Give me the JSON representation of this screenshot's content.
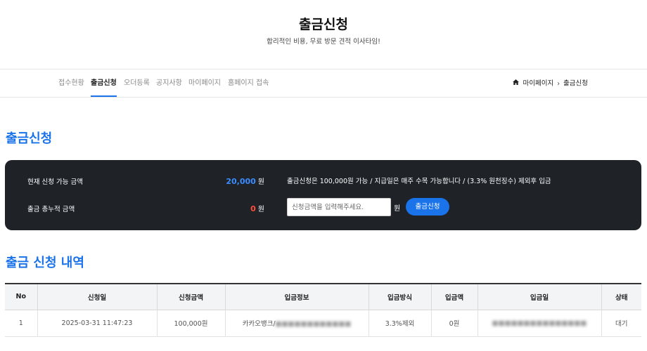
{
  "header": {
    "title": "출금신청",
    "subtitle": "합리적인 비용, 무료 방문 견적 이사타임!"
  },
  "nav": {
    "tabs": [
      "접수현황",
      "출금신청",
      "오더등록",
      "공지사항",
      "마이페이지",
      "홈페이지 접속"
    ],
    "active": "출금신청"
  },
  "breadcrumb": {
    "items": [
      "마이페이지",
      "출금신청"
    ],
    "separator": "›"
  },
  "withdraw": {
    "section_title": "출금신청",
    "available_label": "현재 신청 가능 금액",
    "available_amount": "20,000",
    "total_label": "출금 총누적 금액",
    "total_amount": "0",
    "unit": "원",
    "notice": "출금신청은 100,000원 가능 / 지급일은 매주 수목 가능합니다 / (3.3% 원천징수) 제외후 입금",
    "input_placeholder": "신청금액을 입력해주세요.",
    "input_unit": "원",
    "submit_label": "출금신청"
  },
  "history": {
    "section_title": "출금 신청 내역",
    "columns": [
      "No",
      "신청일",
      "신청금액",
      "입금정보",
      "입금방식",
      "입금액",
      "입금일",
      "상태"
    ],
    "rows": [
      [
        "1",
        "2025-03-31 11:47:23",
        "100,000원",
        "카카오뱅크/",
        "3.3%제외",
        "0원",
        "",
        "대기"
      ]
    ]
  },
  "colors": {
    "accent": "#1a73e8",
    "panel_bg": "#1f2328",
    "available_amount": "#3b8cff",
    "total_amount": "#ff4d3a"
  }
}
